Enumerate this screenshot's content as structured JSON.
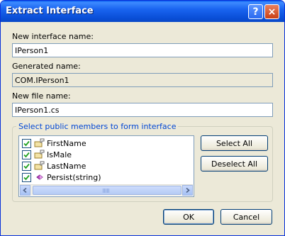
{
  "window": {
    "title": "Extract Interface"
  },
  "titlebar": {
    "help_symbol": "?",
    "close_symbol": "×"
  },
  "form": {
    "interface_name_label": "New interface name:",
    "interface_name_value": "IPerson1",
    "generated_name_label": "Generated name:",
    "generated_name_value": "COM.IPerson1",
    "file_name_label": "New file name:",
    "file_name_value": "IPerson1.cs"
  },
  "members": {
    "group_label": "Select public members to form interface",
    "items": [
      {
        "label": "FirstName",
        "checked": true,
        "icon": "property-icon"
      },
      {
        "label": "IsMale",
        "checked": true,
        "icon": "property-icon"
      },
      {
        "label": "LastName",
        "checked": true,
        "icon": "property-icon"
      },
      {
        "label": "Persist(string)",
        "checked": true,
        "icon": "method-icon"
      }
    ],
    "select_all_label": "Select All",
    "deselect_all_label": "Deselect All"
  },
  "footer": {
    "ok_label": "OK",
    "cancel_label": "Cancel"
  },
  "colors": {
    "titlebar": "#0a4fd8",
    "dialog_bg": "#ece9d8",
    "group_label": "#0046d5",
    "field_border": "#7f9db9"
  }
}
